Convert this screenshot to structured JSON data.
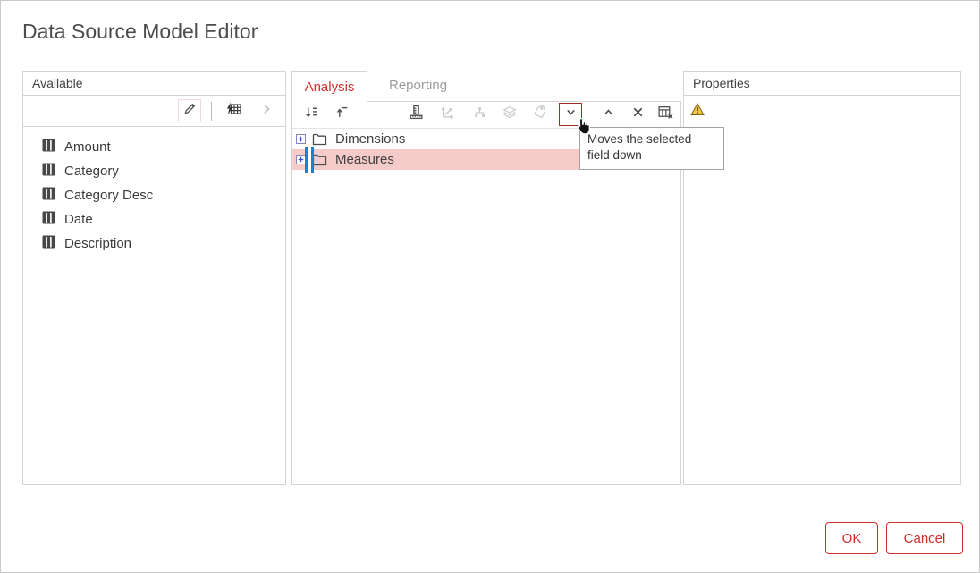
{
  "dialog": {
    "title": "Data Source Model Editor"
  },
  "available_panel": {
    "header": "Available",
    "toolbar_icons": [
      "pencil-icon",
      "lightning-table-icon",
      "chevron-right-icon"
    ],
    "fields": [
      "Amount",
      "Category",
      "Category Desc",
      "Date",
      "Description"
    ]
  },
  "model_panel": {
    "tabs": [
      {
        "label": "Analysis",
        "active": true
      },
      {
        "label": "Reporting",
        "active": false
      }
    ],
    "toolbar_icons": [
      "sort-icon",
      "move-to-top-icon",
      "ruler-icon",
      "axes-icon",
      "hierarchy-icon",
      "layers-icon",
      "tag-icon",
      "move-down-icon",
      "move-up-icon",
      "delete-icon",
      "remove-table-icon"
    ],
    "tree": [
      {
        "label": "Dimensions",
        "selected": false
      },
      {
        "label": "Measures",
        "selected": true
      }
    ]
  },
  "properties_panel": {
    "header": "Properties",
    "warning_icon": "warning-icon"
  },
  "tooltip": {
    "text": "Moves the selected field down"
  },
  "footer": {
    "ok": "OK",
    "cancel": "Cancel"
  },
  "colors": {
    "accent_red": "#d0302d",
    "selection_pink": "#f5cbc9",
    "caret_blue": "#1283d8",
    "warning_yellow": "#f6c63d",
    "icon_dark": "#4f4f4f",
    "icon_disabled": "#c7c7c7"
  }
}
